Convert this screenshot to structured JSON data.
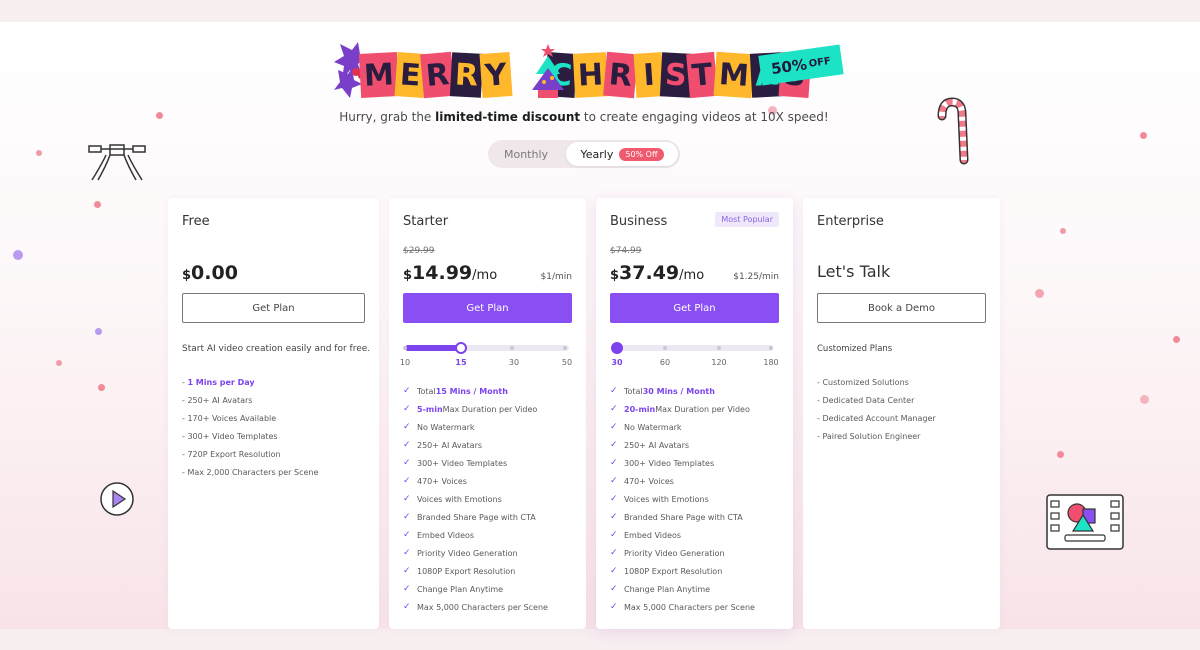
{
  "header": {
    "banner_letters": [
      "M",
      "E",
      "R",
      "R",
      "Y",
      "C",
      "H",
      "R",
      "I",
      "S",
      "T",
      "M",
      "A",
      "S"
    ],
    "off_badge": {
      "amount": "50%",
      "suffix": "OFF"
    },
    "subtitle_pre": "Hurry, grab the ",
    "subtitle_bold": "limited-time discount",
    "subtitle_post": " to create engaging videos at 10X speed!"
  },
  "billing_toggle": {
    "monthly_label": "Monthly",
    "yearly_label": "Yearly",
    "yearly_badge": "50% Off",
    "selected": "Yearly"
  },
  "colors": {
    "accent": "#8a4ff2",
    "accent_text": "#7c43ee",
    "badge_red": "#f05a6e",
    "banner_teal": "#1de3c6"
  },
  "plans": [
    {
      "name": "Free",
      "currency": "$",
      "price": "0.00",
      "button": "Get Plan",
      "description": "Start AI video creation easily and for free.",
      "features": [
        {
          "highlight": "1 Mins per Day",
          "text": ""
        },
        {
          "text": "250+ AI Avatars"
        },
        {
          "text": "170+ Voices Available"
        },
        {
          "text": "300+ Video Templates"
        },
        {
          "text": "720P Export Resolution"
        },
        {
          "text": "Max 2,000 Characters per Scene"
        }
      ]
    },
    {
      "name": "Starter",
      "old_price": "$29.99",
      "currency": "$",
      "price": "14.99",
      "period": "/mo",
      "rate": "$1/min",
      "button": "Get Plan",
      "slider": {
        "ticks": [
          "10",
          "15",
          "30",
          "50"
        ],
        "selected": "15"
      },
      "features": [
        {
          "pre": "Total ",
          "highlight": "15 Mins / Month",
          "text": ""
        },
        {
          "highlight": "5-min",
          "text": " Max Duration per Video"
        },
        {
          "text": "No Watermark"
        },
        {
          "text": "250+ AI Avatars"
        },
        {
          "text": "300+ Video Templates"
        },
        {
          "text": "470+ Voices"
        },
        {
          "text": "Voices with Emotions"
        },
        {
          "text": "Branded Share Page with CTA"
        },
        {
          "text": "Embed Videos"
        },
        {
          "text": "Priority Video Generation"
        },
        {
          "text": "1080P Export Resolution"
        },
        {
          "text": "Change Plan Anytime"
        },
        {
          "text": "Max 5,000 Characters per Scene"
        }
      ]
    },
    {
      "name": "Business",
      "badge": "Most Popular",
      "old_price": "$74.99",
      "currency": "$",
      "price": "37.49",
      "period": "/mo",
      "rate": "$1.25/min",
      "button": "Get Plan",
      "slider": {
        "ticks": [
          "30",
          "60",
          "120",
          "180"
        ],
        "selected": "30"
      },
      "features": [
        {
          "pre": "Total ",
          "highlight": "30 Mins / Month",
          "text": ""
        },
        {
          "highlight": "20-min",
          "text": " Max Duration per Video"
        },
        {
          "text": "No Watermark"
        },
        {
          "text": "250+ AI Avatars"
        },
        {
          "text": "300+ Video Templates"
        },
        {
          "text": "470+ Voices"
        },
        {
          "text": "Voices with Emotions"
        },
        {
          "text": "Branded Share Page with CTA"
        },
        {
          "text": "Embed Videos"
        },
        {
          "text": "Priority Video Generation"
        },
        {
          "text": "1080P Export Resolution"
        },
        {
          "text": "Change Plan Anytime"
        },
        {
          "text": "Max 5,000 Characters per Scene"
        }
      ]
    },
    {
      "name": "Enterprise",
      "headline": "Let's Talk",
      "button": "Book a Demo",
      "description": "Customized Plans",
      "features": [
        {
          "text": "Customized Solutions"
        },
        {
          "text": "Dedicated Data Center"
        },
        {
          "text": "Dedicated Account Manager"
        },
        {
          "text": "Paired Solution Engineer"
        }
      ]
    }
  ],
  "icons": {
    "play": "play-circle-icon",
    "gallery": "video-gallery-icon",
    "candy_cane": "candy-cane-icon",
    "drone": "drone-icon"
  }
}
